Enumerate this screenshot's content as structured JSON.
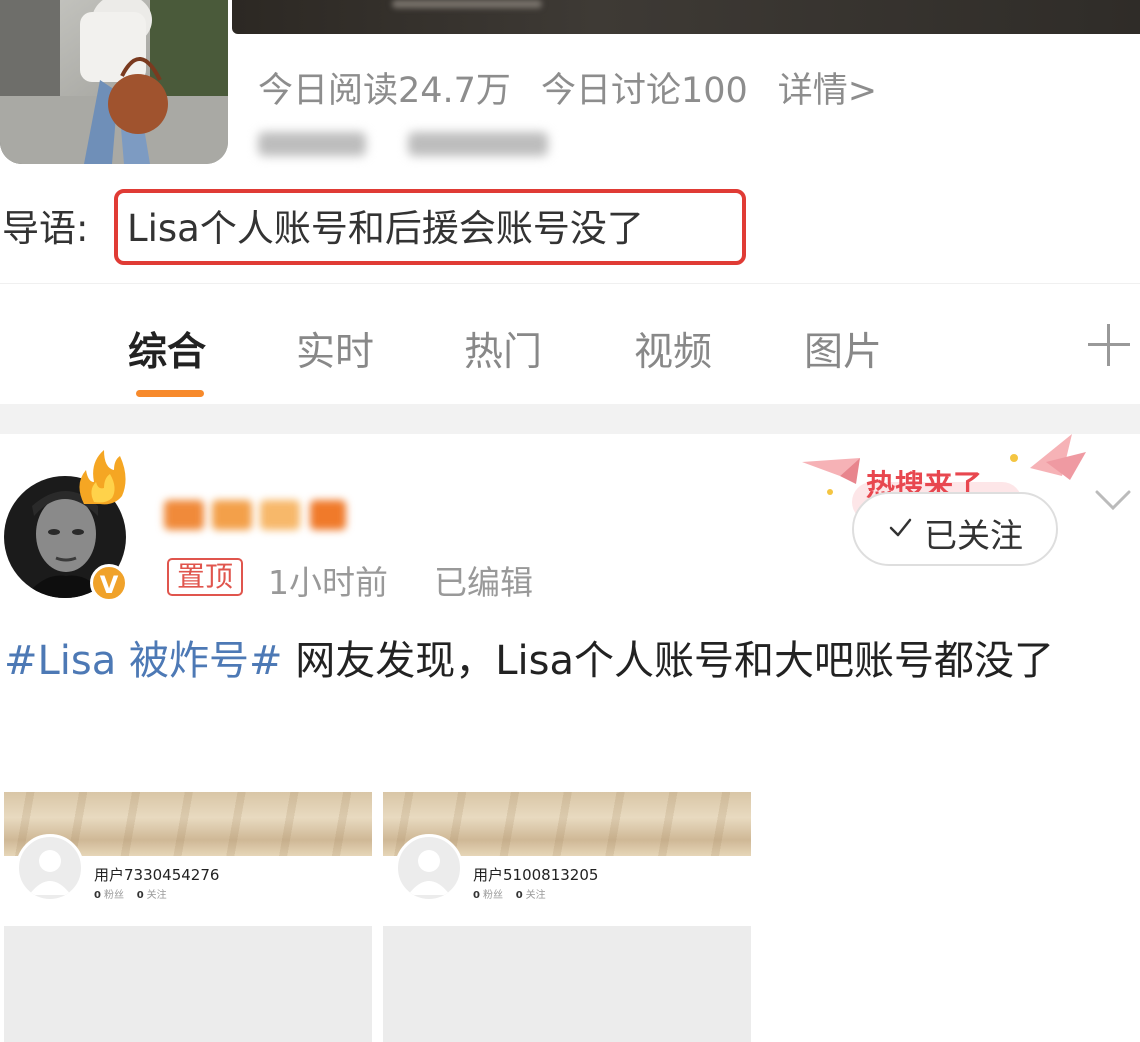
{
  "topic": {
    "read_label": "今日阅读24.7万",
    "discuss_label": "今日讨论100",
    "details_link": "详情>",
    "guide_label": "导语:",
    "guide_text": "Lisa个人账号和后援会账号没了"
  },
  "tabs": [
    {
      "label": "综合",
      "active": true
    },
    {
      "label": "实时",
      "active": false
    },
    {
      "label": "热门",
      "active": false
    },
    {
      "label": "视频",
      "active": false
    },
    {
      "label": "图片",
      "active": false
    }
  ],
  "post": {
    "pin_badge": "置顶",
    "time": "1小时前",
    "edited": "已编辑",
    "verified_icon": "V",
    "hot_banner": "热搜来了",
    "follow_label": "已关注",
    "hashtag": "#Lisa 被炸号#",
    "body": " 网友发现，Lisa个人账号和大吧账号都没了",
    "images": [
      {
        "user": "用户7330454276",
        "fans_count": "0",
        "fans_label": "粉丝",
        "follow_count": "0",
        "follow_label": "关注"
      },
      {
        "user": "用户5100813205",
        "fans_count": "0",
        "fans_label": "粉丝",
        "follow_count": "0",
        "follow_label": "关注"
      }
    ]
  },
  "colors": {
    "accent_orange": "#f78a2c",
    "hashtag_blue": "#4d79b5",
    "highlight_red": "#e03b35"
  },
  "icons": [
    "plus-icon",
    "check-icon",
    "chevron-down-icon",
    "verified-badge-icon",
    "flame-icon"
  ]
}
